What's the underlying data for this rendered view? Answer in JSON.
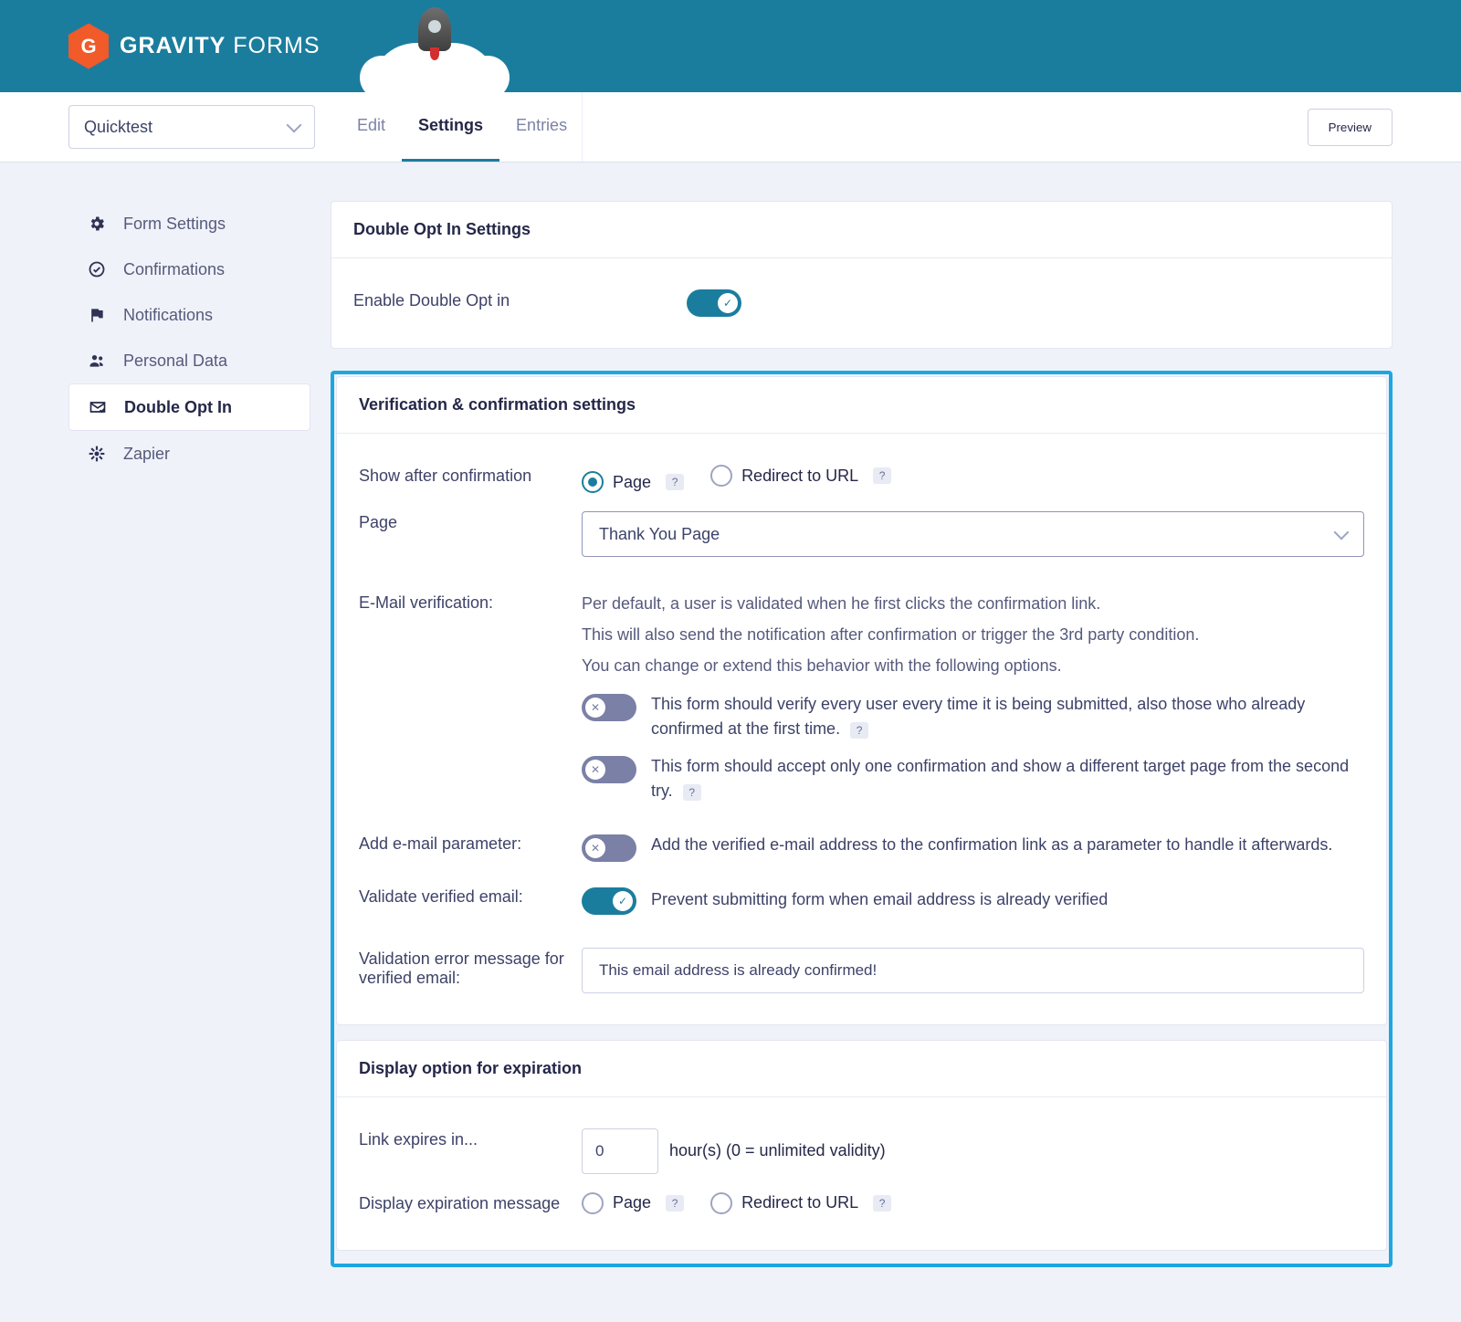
{
  "brand": {
    "heavy": "GRAVITY",
    "light": "FORMS",
    "mark": "G"
  },
  "toolbar": {
    "form_selector": "Quicktest",
    "tabs": {
      "edit": "Edit",
      "settings": "Settings",
      "entries": "Entries"
    },
    "preview": "Preview"
  },
  "sidebar": [
    {
      "label": "Form Settings"
    },
    {
      "label": "Confirmations"
    },
    {
      "label": "Notifications"
    },
    {
      "label": "Personal Data"
    },
    {
      "label": "Double Opt In"
    },
    {
      "label": "Zapier"
    }
  ],
  "panel1": {
    "title": "Double Opt In Settings",
    "enable_label": "Enable Double Opt in"
  },
  "panel2": {
    "title": "Verification & confirmation settings",
    "show_after_label": "Show after confirmation",
    "radio_page": "Page",
    "radio_redirect": "Redirect to URL",
    "page_label": "Page",
    "page_value": "Thank You Page",
    "email_verif_label": "E-Mail verification:",
    "desc_l1": "Per default, a user is validated when he first clicks the confirmation link.",
    "desc_l2": "This will also send the notification after confirmation or trigger the 3rd party condition.",
    "desc_l3": "You can change or extend this behavior with the following options.",
    "opt1": "This form should verify every user every time it is being submitted, also those who already confirmed at the first time.",
    "opt2": "This form should accept only one confirmation and show a different target page from the second try.",
    "add_param_label": "Add e-mail parameter:",
    "add_param_text": "Add the verified e-mail address to the confirmation link as a parameter to handle it afterwards.",
    "validate_label": "Validate verified email:",
    "validate_text": "Prevent submitting form when email address is already verified",
    "err_label": "Validation error message for verified email:",
    "err_value": "This email address is already confirmed!"
  },
  "panel3": {
    "title": "Display option for expiration",
    "expire_label": "Link expires in...",
    "expire_value": "0",
    "expire_suffix": "hour(s) (0 = unlimited validity)",
    "disp_msg_label": "Display expiration message",
    "radio_page": "Page",
    "radio_redirect": "Redirect to URL"
  },
  "help": "?"
}
